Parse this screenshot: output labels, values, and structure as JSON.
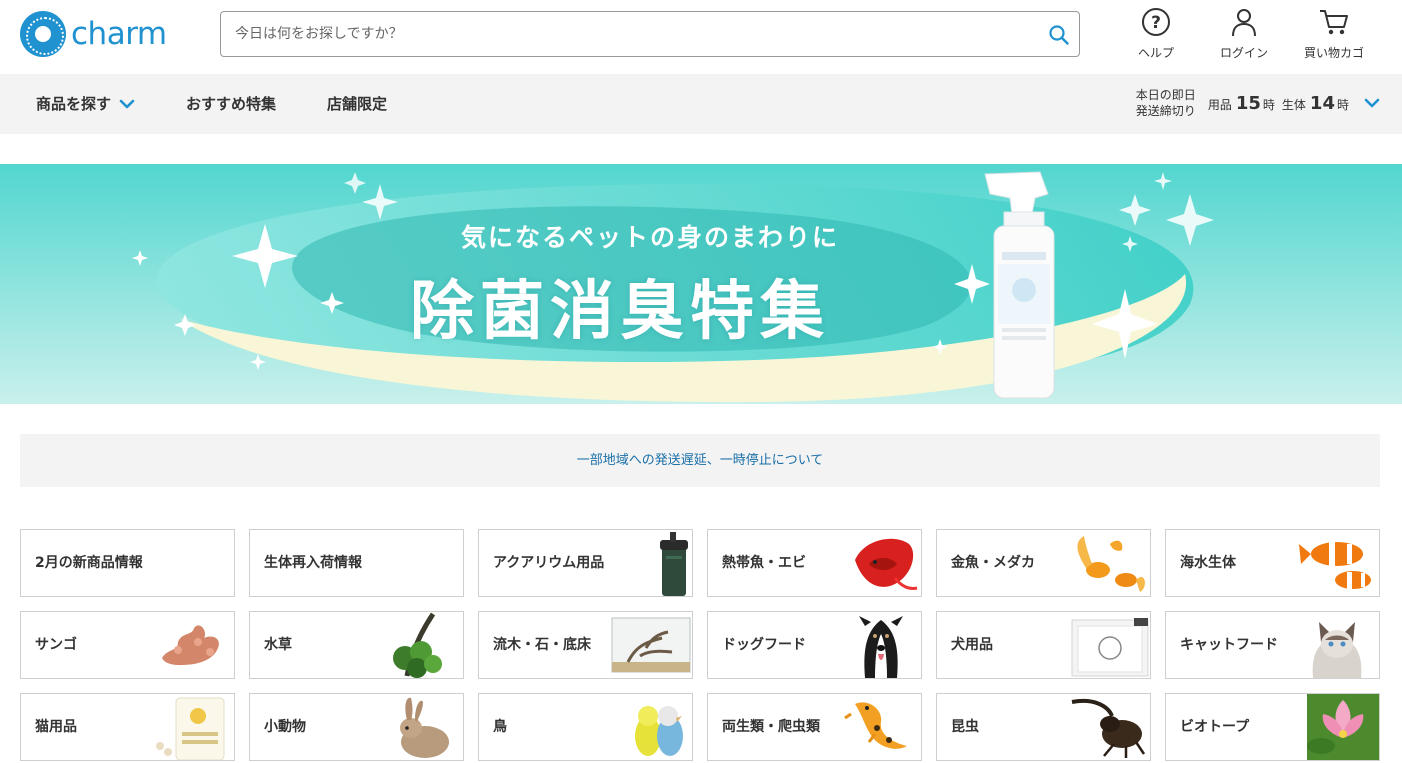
{
  "header": {
    "logo_text": "charm",
    "search_placeholder": "今日は何をお探しですか？",
    "help_label": "ヘルプ",
    "login_label": "ログイン",
    "cart_label": "買い物カゴ"
  },
  "nav": {
    "items": [
      "商品を探す",
      "おすすめ特集",
      "店舗限定"
    ],
    "cutoff_label_line1": "本日の即日",
    "cutoff_label_line2": "発送締切り",
    "supplies_label": "用品",
    "supplies_hour": "15",
    "livestock_label": "生体",
    "livestock_hour": "14",
    "hour_unit": "時"
  },
  "banner": {
    "subtitle": "気になるペットの身のまわりに",
    "title": "除菌消臭特集"
  },
  "notice": {
    "text": "一部地域への発送遅延、一時停止について"
  },
  "categories": [
    {
      "label": "2月の新商品情報",
      "icon": "none"
    },
    {
      "label": "生体再入荷情報",
      "icon": "none"
    },
    {
      "label": "アクアリウム用品",
      "icon": "filter-canister"
    },
    {
      "label": "熱帯魚・エビ",
      "icon": "betta-fish"
    },
    {
      "label": "金魚・メダカ",
      "icon": "goldfish"
    },
    {
      "label": "海水生体",
      "icon": "clownfish"
    },
    {
      "label": "サンゴ",
      "icon": "coral"
    },
    {
      "label": "水草",
      "icon": "aquatic-plant"
    },
    {
      "label": "流木・石・底床",
      "icon": "driftwood-tank"
    },
    {
      "label": "ドッグフード",
      "icon": "dog"
    },
    {
      "label": "犬用品",
      "icon": "pet-sheets"
    },
    {
      "label": "キャットフード",
      "icon": "cat"
    },
    {
      "label": "猫用品",
      "icon": "cat-litter"
    },
    {
      "label": "小動物",
      "icon": "rabbit"
    },
    {
      "label": "鳥",
      "icon": "parakeets"
    },
    {
      "label": "両生類・爬虫類",
      "icon": "gecko"
    },
    {
      "label": "昆虫",
      "icon": "beetle"
    },
    {
      "label": "ビオトープ",
      "icon": "water-lily"
    }
  ]
}
